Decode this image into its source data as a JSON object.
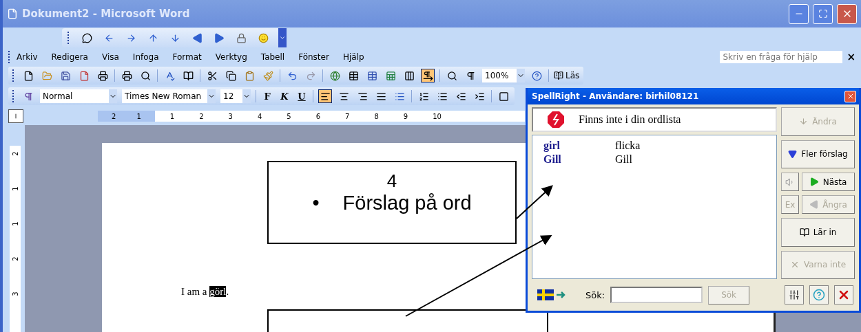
{
  "window": {
    "title": "Dokument2 - Microsoft Word"
  },
  "menu": [
    "Arkiv",
    "Redigera",
    "Visa",
    "Infoga",
    "Format",
    "Verktyg",
    "Tabell",
    "Fönster",
    "Hjälp"
  ],
  "help_search": {
    "placeholder": "Skriv en fråga för hjälp",
    "close": "×"
  },
  "standard_toolbar": {
    "zoom": "100%",
    "read_button": "Läs",
    "research_selected": true
  },
  "formatting_toolbar": {
    "style": "Normal",
    "font": "Times New Roman",
    "size": "12",
    "bold": "F",
    "italic": "K",
    "underline": "U",
    "align": [
      {
        "selected": true
      },
      {
        "selected": false
      },
      {
        "selected": false
      },
      {
        "selected": false
      }
    ]
  },
  "ruler": {
    "left_labels": [
      "2",
      "1"
    ],
    "labels": [
      "1",
      "2",
      "3",
      "4",
      "5",
      "6",
      "7",
      "8",
      "9",
      "10"
    ],
    "vertical_labels": [
      "2",
      "1",
      "1",
      "2",
      "3"
    ]
  },
  "document": {
    "before": "I am a ",
    "highlighted": "görl",
    "after": "."
  },
  "annotations": [
    {
      "kind": "box",
      "number": "4",
      "bullet": "•",
      "text": "Förslag på ord"
    },
    {
      "kind": "box"
    }
  ],
  "spellright": {
    "title": "SpellRight - Användare: birhil08121",
    "message": "Finns inte i din ordlista",
    "suggestions": [
      {
        "word": "girl",
        "translation": "flicka"
      },
      {
        "word": "Gill",
        "translation": "Gill"
      }
    ],
    "buttons": [
      {
        "kind": "change",
        "label": "Ändra",
        "disabled": true
      },
      {
        "kind": "more",
        "label": "Fler förslag",
        "disabled": false
      },
      {
        "kind": "next",
        "label": "Nästa",
        "disabled": false
      },
      {
        "kind": "undo",
        "label": "Ångra",
        "disabled": true
      },
      {
        "kind": "learn",
        "label": "Lär in",
        "disabled": false
      },
      {
        "kind": "ignore",
        "label": "Varna inte",
        "disabled": true
      }
    ],
    "example_button": "Ex",
    "search_label": "Sök:",
    "search_button": "Sök"
  }
}
